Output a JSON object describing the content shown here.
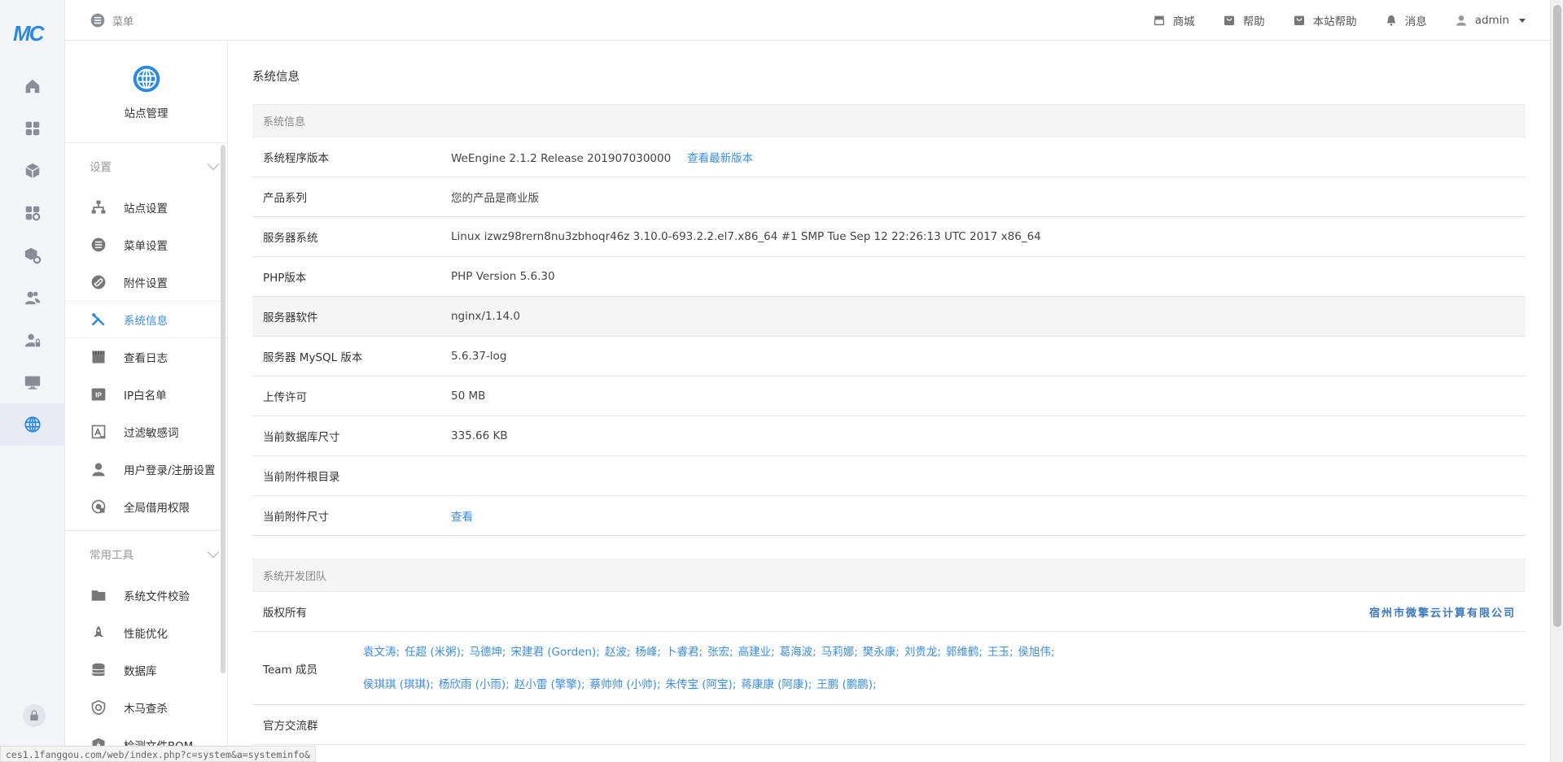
{
  "app": {
    "logo": "MC"
  },
  "iconbar": [
    {
      "icon": "home-icon"
    },
    {
      "icon": "apps-icon"
    },
    {
      "icon": "cube-icon"
    },
    {
      "icon": "apps-settings-icon"
    },
    {
      "icon": "module-settings-icon"
    },
    {
      "icon": "users-icon"
    },
    {
      "icon": "user-lock-icon"
    },
    {
      "icon": "monitor-icon"
    },
    {
      "icon": "globe-icon",
      "active": true
    }
  ],
  "topbar": {
    "menu_label": "菜单",
    "items": [
      {
        "label": "商城",
        "icon": "store-icon"
      },
      {
        "label": "帮助",
        "icon": "help-bag-icon"
      },
      {
        "label": "本站帮助",
        "icon": "help-bag-icon"
      },
      {
        "label": "消息",
        "icon": "bell-icon"
      }
    ],
    "user": "admin"
  },
  "sidebar": {
    "site_title": "站点管理",
    "sections": [
      {
        "title": "设置",
        "items": [
          {
            "label": "站点设置",
            "icon": "sitemap-icon"
          },
          {
            "label": "菜单设置",
            "icon": "list-icon"
          },
          {
            "label": "附件设置",
            "icon": "attachment-icon"
          },
          {
            "label": "系统信息",
            "icon": "tools-icon",
            "active": true
          },
          {
            "label": "查看日志",
            "icon": "log-icon"
          },
          {
            "label": "IP白名单",
            "icon": "ip-icon"
          },
          {
            "label": "过滤敏感词",
            "icon": "filter-words-icon"
          },
          {
            "label": "用户登录/注册设置",
            "icon": "user-icon"
          },
          {
            "label": "全局借用权限",
            "icon": "permission-icon"
          }
        ]
      },
      {
        "title": "常用工具",
        "items": [
          {
            "label": "系统文件校验",
            "icon": "folder-icon"
          },
          {
            "label": "性能优化",
            "icon": "rocket-icon"
          },
          {
            "label": "数据库",
            "icon": "database-icon"
          },
          {
            "label": "木马查杀",
            "icon": "shield-scan-icon"
          },
          {
            "label": "检测文件BOM",
            "icon": "shield-bolt-icon"
          }
        ]
      }
    ]
  },
  "main": {
    "page_title": "系统信息",
    "system_panel": {
      "title": "系统信息",
      "rows": [
        {
          "key": "系统程序版本",
          "value": "WeEngine 2.1.2 Release 201907030000",
          "link": "查看最新版本"
        },
        {
          "key": "产品系列",
          "value": "您的产品是商业版"
        },
        {
          "key": "服务器系统",
          "value": "Linux izwz98rern8nu3zbhoqr46z 3.10.0-693.2.2.el7.x86_64 #1 SMP Tue Sep 12 22:26:13 UTC 2017 x86_64"
        },
        {
          "key": "PHP版本",
          "value": "PHP Version 5.6.30"
        },
        {
          "key": "服务器软件",
          "value": "nginx/1.14.0",
          "highlight": true
        },
        {
          "key": "服务器 MySQL 版本",
          "value": "5.6.37-log"
        },
        {
          "key": "上传许可",
          "value": "50 MB"
        },
        {
          "key": "当前数据库尺寸",
          "value": "335.66 KB"
        },
        {
          "key": "当前附件根目录",
          "value": ""
        },
        {
          "key": "当前附件尺寸",
          "value": "",
          "link": "查看"
        }
      ]
    },
    "team_panel": {
      "title": "系统开发团队",
      "copyright_label": "版权所有",
      "company": "宿州市微擎云计算有限公司",
      "team_label": "Team 成员",
      "members_line1": [
        "袁文涛;",
        "任超 (米粥);",
        "马德坤;",
        "宋建君 (Gorden);",
        "赵波;",
        "杨峰;",
        "卜睿君;",
        "张宏;",
        "高建业;",
        "葛海波;",
        "马莉娜;",
        "樊永康;",
        "刘贵龙;",
        "郭维鹤;",
        "王玉;",
        "侯旭伟;"
      ],
      "members_line2": [
        "侯琪琪 (琪琪);",
        "杨欣雨 (小雨);",
        "赵小雷 (擎擎);",
        "蔡帅帅 (小帅);",
        "朱传宝 (阿宝);",
        "蒋康康 (阿康);",
        "王鹏 (鹏鹏);"
      ],
      "group_label": "官方交流群"
    }
  },
  "status_url": "ces1.1fanggou.com/web/index.php?c=system&a=systeminfo&"
}
